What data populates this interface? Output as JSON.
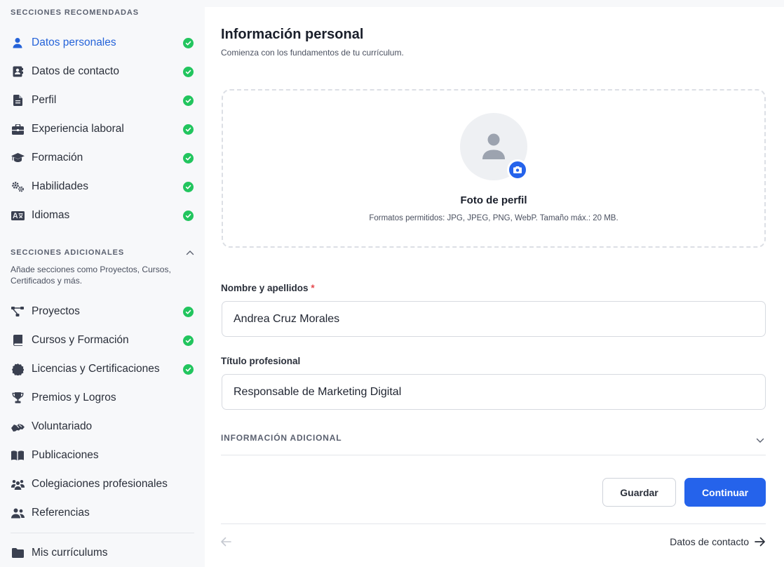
{
  "sidebar": {
    "recommended_title": "SECCIONES RECOMENDADAS",
    "recommended": [
      {
        "label": "Datos personales",
        "icon": "user-icon",
        "done": true,
        "active": true
      },
      {
        "label": "Datos de contacto",
        "icon": "contact-card-icon",
        "done": true
      },
      {
        "label": "Perfil",
        "icon": "document-icon",
        "done": true
      },
      {
        "label": "Experiencia laboral",
        "icon": "briefcase-icon",
        "done": true
      },
      {
        "label": "Formación",
        "icon": "graduation-cap-icon",
        "done": true
      },
      {
        "label": "Habilidades",
        "icon": "gears-icon",
        "done": true
      },
      {
        "label": "Idiomas",
        "icon": "language-icon",
        "done": true
      }
    ],
    "additional_title": "SECCIONES ADICIONALES",
    "additional_desc": "Añade secciones como Proyectos, Cursos, Certificados y más.",
    "additional": [
      {
        "label": "Proyectos",
        "icon": "diagram-icon",
        "done": true
      },
      {
        "label": "Cursos y Formación",
        "icon": "book-icon",
        "done": true
      },
      {
        "label": "Licencias y Certificaciones",
        "icon": "certificate-icon",
        "done": true
      },
      {
        "label": "Premios y Logros",
        "icon": "trophy-icon",
        "done": false
      },
      {
        "label": "Voluntariado",
        "icon": "handshake-icon",
        "done": false
      },
      {
        "label": "Publicaciones",
        "icon": "open-book-icon",
        "done": false
      },
      {
        "label": "Colegiaciones profesionales",
        "icon": "people-group-icon",
        "done": false
      },
      {
        "label": "Referencias",
        "icon": "people-icon",
        "done": false
      }
    ],
    "resumes_label": "Mis currículums"
  },
  "main": {
    "title": "Información personal",
    "subtitle": "Comienza con los fundamentos de tu currículum.",
    "photo_title": "Foto de perfil",
    "photo_hint": "Formatos permitidos: JPG, JPEG, PNG, WebP. Tamaño máx.: 20 MB.",
    "name_label": "Nombre y apellidos",
    "required_mark": "*",
    "name_value": "Andrea Cruz Morales",
    "job_label": "Título profesional",
    "job_value": "Responsable de Marketing Digital",
    "extra_label": "INFORMACIÓN ADICIONAL",
    "save_label": "Guardar",
    "continue_label": "Continuar",
    "next_label": "Datos de contacto"
  },
  "colors": {
    "accent": "#2563eb",
    "check": "#22c55e",
    "required": "#e5484d"
  }
}
